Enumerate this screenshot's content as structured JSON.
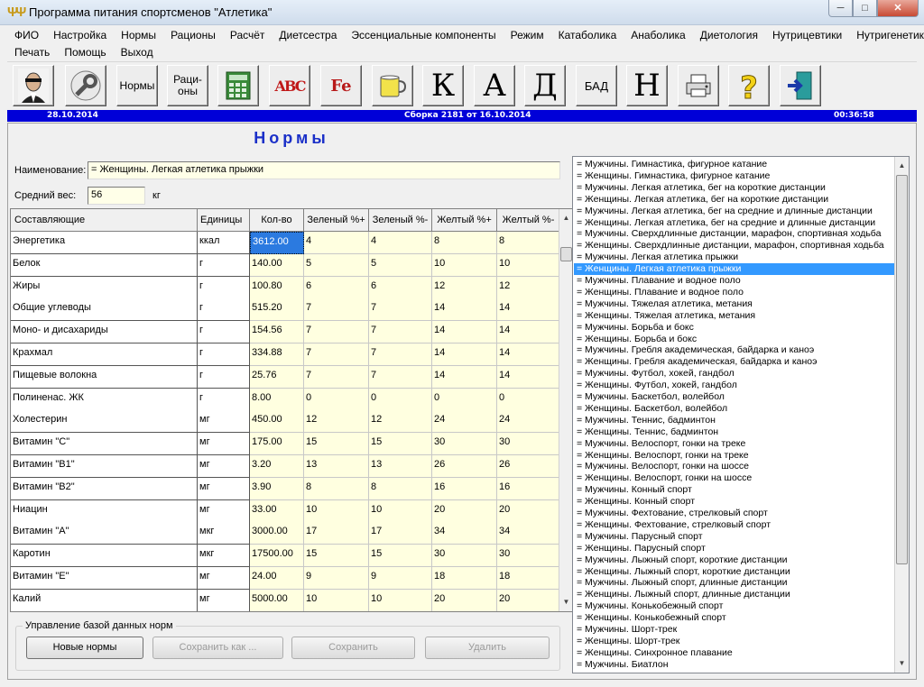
{
  "window": {
    "title": "Программа питания спортсменов \"Атлетика\"",
    "min": "─",
    "max": "□",
    "close": "✕"
  },
  "menu": {
    "row1": [
      "ФИО",
      "Настройка",
      "Нормы",
      "Рационы",
      "Расчёт",
      "Диетсестра",
      "Эссенциальные компоненты",
      "Режим",
      "Катаболика",
      "Анаболика",
      "Диетология",
      "Нутрицевтики",
      "Нутригенетика"
    ],
    "row2": [
      "Печать",
      "Помощь",
      "Выход"
    ]
  },
  "toolbar": {
    "norms": "Нормы",
    "rations1": "Раци-",
    "rations2": "оны",
    "letter_k": "К",
    "letter_a": "А",
    "letter_d": "Д",
    "bad": "БАД",
    "letter_n": "Н",
    "abc": "ABC",
    "fe": "Fe",
    "q": "?"
  },
  "status": {
    "date": "28.10.2014",
    "build": "Сборка 2181 от 16.10.2014",
    "time": "00:36:58"
  },
  "main": {
    "heading": "Нормы",
    "name_label": "Наименование:",
    "name_value": "= Женщины. Легкая атлетика прыжки",
    "weight_label": "Средний вес:",
    "weight_value": "56",
    "weight_unit": "кг"
  },
  "grid": {
    "headers": [
      "Составляющие",
      "Единицы",
      "Кол-во",
      "Зеленый %+",
      "Зеленый %-",
      "Желтый %+",
      "Желтый %-"
    ],
    "rows": [
      [
        "Энергетика",
        "ккал",
        "3612.00",
        "4",
        "4",
        "8",
        "8"
      ],
      [
        "Белок",
        "г",
        "140.00",
        "5",
        "5",
        "10",
        "10"
      ],
      [
        "Жиры",
        "г",
        "100.80",
        "6",
        "6",
        "12",
        "12"
      ],
      [
        "Общие углеводы",
        "г",
        "515.20",
        "7",
        "7",
        "14",
        "14"
      ],
      [
        "Моно- и дисахариды",
        "г",
        "154.56",
        "7",
        "7",
        "14",
        "14"
      ],
      [
        "Крахмал",
        "г",
        "334.88",
        "7",
        "7",
        "14",
        "14"
      ],
      [
        "Пищевые волокна",
        "г",
        "25.76",
        "7",
        "7",
        "14",
        "14"
      ],
      [
        "Полиненас. ЖК",
        "г",
        "8.00",
        "0",
        "0",
        "0",
        "0"
      ],
      [
        "Холестерин",
        "мг",
        "450.00",
        "12",
        "12",
        "24",
        "24"
      ],
      [
        "Витамин \"С\"",
        "мг",
        "175.00",
        "15",
        "15",
        "30",
        "30"
      ],
      [
        "Витамин \"В1\"",
        "мг",
        "3.20",
        "13",
        "13",
        "26",
        "26"
      ],
      [
        "Витамин \"В2\"",
        "мг",
        "3.90",
        "8",
        "8",
        "16",
        "16"
      ],
      [
        "Ниацин",
        "мг",
        "33.00",
        "10",
        "10",
        "20",
        "20"
      ],
      [
        "Витамин \"А\"",
        "мкг",
        "3000.00",
        "17",
        "17",
        "34",
        "34"
      ],
      [
        "Каротин",
        "мкг",
        "17500.00",
        "15",
        "15",
        "30",
        "30"
      ],
      [
        "Витамин \"Е\"",
        "мг",
        "24.00",
        "9",
        "9",
        "18",
        "18"
      ],
      [
        "Калий",
        "мг",
        "5000.00",
        "10",
        "10",
        "20",
        "20"
      ]
    ]
  },
  "db": {
    "group_label": "Управление базой данных норм",
    "new": "Новые нормы",
    "save_as": "Сохранить как ...",
    "save": "Сохранить",
    "delete": "Удалить"
  },
  "list": {
    "selected_index": 9,
    "items": [
      "= Мужчины.   Гимнастика, фигурное катание",
      "= Женщины. Гимнастика, фигурное катание",
      "= Мужчины.   Легкая атлетика, бег на короткие дистанции",
      "= Женщины. Легкая атлетика, бег на короткие дистанции",
      "= Мужчины.   Легкая атлетика, бег на средние и длинные дистанции",
      "= Женщины. Легкая атлетика, бег на средние и длинные дистанции",
      "= Мужчины.   Сверхдлинные дистанции, марафон, спортивная ходьба",
      "= Женщины. Сверхдлинные дистанции, марафон, спортивная ходьба",
      "= Мужчины.   Легкая атлетика прыжки",
      "= Женщины. Легкая атлетика прыжки",
      "= Мужчины.   Плавание и водное поло",
      "= Женщины. Плавание и водное поло",
      "= Мужчины.   Тяжелая атлетика, метания",
      "= Женщины. Тяжелая атлетика, метания",
      "= Мужчины.   Борьба и бокс",
      "= Женщины. Борьба и бокс",
      "= Мужчины.   Гребля академическая, байдарка и каноэ",
      "= Женщины. Гребля академическая, байдарка и каноэ",
      "= Мужчины.   Футбол, хокей, гандбол",
      "= Женщины. Футбол, хокей, гандбол",
      "= Мужчины.   Баскетбол, волейбол",
      "= Женщины. Баскетбол, волейбол",
      "= Мужчины.   Теннис, бадминтон",
      "= Женщины. Теннис, бадминтон",
      "= Мужчины.   Велоспорт, гонки на треке",
      "= Женщины. Велоспорт, гонки на треке",
      "= Мужчины.   Велоспорт, гонки на шоссе",
      "= Женщины. Велоспорт, гонки на шоссе",
      "= Мужчины.   Конный спорт",
      "= Женщины. Конный спорт",
      "= Мужчины.   Фехтование, стрелковый спорт",
      "= Женщины. Фехтование, стрелковый спорт",
      "= Мужчины.   Парусный спорт",
      "= Женщины. Парусный спорт",
      "= Мужчины.   Лыжный спорт, короткие дистанции",
      "= Женщины. Лыжный спорт, короткие дистанции",
      "= Мужчины.   Лыжный спорт, длинные дистанции",
      "= Женщины. Лыжный спорт, длинные дистанции",
      "= Мужчины.   Конькобежный спорт",
      "= Женщины. Конькобежный спорт",
      "= Мужчины.   Шорт-трек",
      "= Женщины. Шорт-трек",
      "= Женщины. Синхронное плавание",
      "= Мужчины.   Биатлон"
    ]
  },
  "icons": [
    "app-fork-icon",
    "user-portrait-icon",
    "wrench-settings-icon",
    "calculator-icon",
    "abc-letters-icon",
    "vitamin-c-fe-icon",
    "cup-icon",
    "printer-icon",
    "help-question-icon",
    "exit-door-icon"
  ],
  "colors": {
    "status_bg": "#0000d8",
    "heading": "#1a2fc8",
    "selection": "#3399ff",
    "grid_data": "#ffffe0"
  }
}
